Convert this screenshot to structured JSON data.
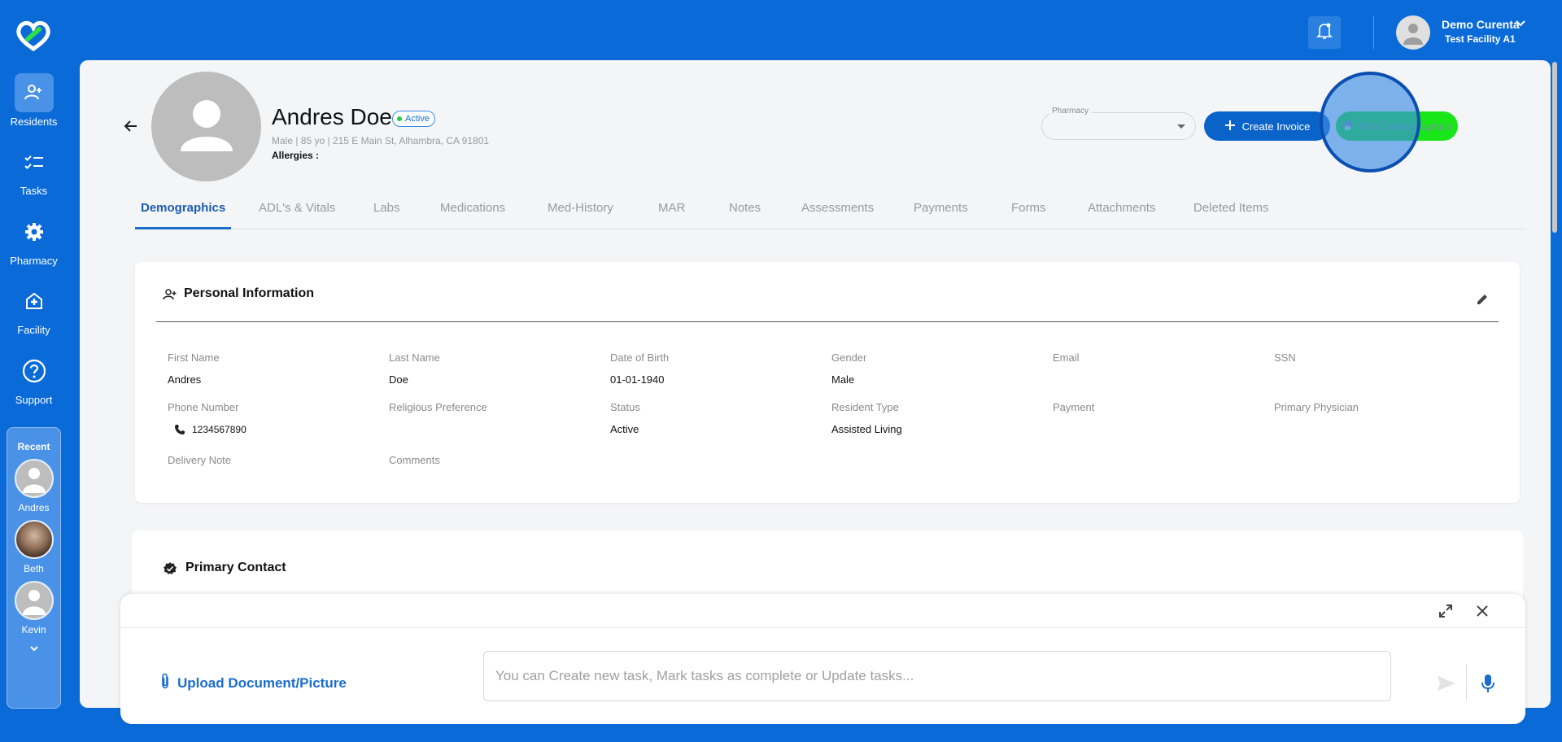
{
  "sidebar": {
    "items": [
      {
        "label": "Residents",
        "icon": "residents-icon"
      },
      {
        "label": "Tasks",
        "icon": "tasks-icon"
      },
      {
        "label": "Pharmacy",
        "icon": "gear-icon"
      },
      {
        "label": "Facility",
        "icon": "facility-icon"
      },
      {
        "label": "Support",
        "icon": "help-icon"
      }
    ],
    "recent": {
      "title": "Recent",
      "people": [
        {
          "name": "Andres"
        },
        {
          "name": "Beth"
        },
        {
          "name": "Kevin"
        }
      ]
    }
  },
  "header": {
    "user_name": "Demo Curenta",
    "facility": "Test Facility A1"
  },
  "resident": {
    "name": "Andres Doe",
    "status": "Active",
    "meta": "Male | 85 yo | 215 E Main St, Alhambra, CA 91801",
    "allergies_label": "Allergies :"
  },
  "actions": {
    "pharmacy_label": "Pharmacy",
    "create_invoice": "Create Invoice",
    "print_demographics": "Print Demographics"
  },
  "tabs": [
    {
      "label": "Demographics"
    },
    {
      "label": "ADL's & Vitals"
    },
    {
      "label": "Labs"
    },
    {
      "label": "Medications"
    },
    {
      "label": "Med-History"
    },
    {
      "label": "MAR"
    },
    {
      "label": "Notes"
    },
    {
      "label": "Assessments"
    },
    {
      "label": "Payments"
    },
    {
      "label": "Forms"
    },
    {
      "label": "Attachments"
    },
    {
      "label": "Deleted Items"
    }
  ],
  "personal_info": {
    "title": "Personal Information",
    "fields": {
      "first_name": {
        "label": "First Name",
        "value": "Andres"
      },
      "last_name": {
        "label": "Last Name",
        "value": "Doe"
      },
      "dob": {
        "label": "Date of Birth",
        "value": "01-01-1940"
      },
      "gender": {
        "label": "Gender",
        "value": "Male"
      },
      "email": {
        "label": "Email",
        "value": ""
      },
      "ssn": {
        "label": "SSN",
        "value": ""
      },
      "phone": {
        "label": "Phone Number",
        "value": "1234567890"
      },
      "religion": {
        "label": "Religious Preference",
        "value": ""
      },
      "status": {
        "label": "Status",
        "value": "Active"
      },
      "resident_type": {
        "label": "Resident Type",
        "value": "Assisted Living"
      },
      "payment": {
        "label": "Payment",
        "value": ""
      },
      "physician": {
        "label": "Primary Physician",
        "value": ""
      },
      "delivery_note": {
        "label": "Delivery Note",
        "value": ""
      },
      "comments": {
        "label": "Comments",
        "value": ""
      }
    }
  },
  "primary_contact": {
    "title": "Primary Contact"
  },
  "chat": {
    "upload_label": "Upload Document/Picture",
    "input_placeholder": "You can Create new task, Mark tasks as complete or Update tasks...",
    "input_value": ""
  },
  "colors": {
    "brand_blue": "#0a6bd8",
    "accent_green": "#19e619",
    "invoice_blue": "#0a63c9",
    "status_green": "#28c840"
  }
}
